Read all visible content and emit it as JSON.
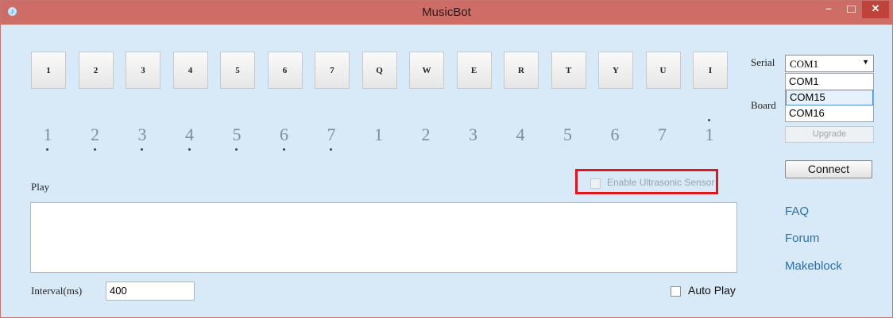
{
  "window": {
    "title": "MusicBot",
    "controls": {
      "minimize": "–",
      "close": "✕"
    }
  },
  "keys": [
    {
      "label": "1",
      "note": "1",
      "dot": "below"
    },
    {
      "label": "2",
      "note": "2",
      "dot": "below"
    },
    {
      "label": "3",
      "note": "3",
      "dot": "below"
    },
    {
      "label": "4",
      "note": "4",
      "dot": "below"
    },
    {
      "label": "5",
      "note": "5",
      "dot": "below"
    },
    {
      "label": "6",
      "note": "6",
      "dot": "below"
    },
    {
      "label": "7",
      "note": "7",
      "dot": "below"
    },
    {
      "label": "Q",
      "note": "1",
      "dot": "none"
    },
    {
      "label": "W",
      "note": "2",
      "dot": "none"
    },
    {
      "label": "E",
      "note": "3",
      "dot": "none"
    },
    {
      "label": "R",
      "note": "4",
      "dot": "none"
    },
    {
      "label": "T",
      "note": "5",
      "dot": "none"
    },
    {
      "label": "Y",
      "note": "6",
      "dot": "none"
    },
    {
      "label": "U",
      "note": "7",
      "dot": "none"
    },
    {
      "label": "I",
      "note": "1",
      "dot": "above"
    }
  ],
  "play": {
    "label": "Play",
    "content": ""
  },
  "sensor": {
    "label": "Enable Ultrasonic Sensor",
    "checked": false,
    "enabled": false,
    "highlight_color": "#e2151f"
  },
  "interval": {
    "label": "Interval(ms)",
    "value": "400"
  },
  "auto_play": {
    "label": "Auto Play",
    "checked": false
  },
  "serial": {
    "label": "Serial",
    "selected": "COM1",
    "options": [
      "COM1",
      "COM15",
      "COM16"
    ],
    "highlighted": "COM15"
  },
  "board": {
    "label": "Board"
  },
  "buttons": {
    "upgrade": "Upgrade",
    "connect": "Connect"
  },
  "links": [
    "FAQ",
    "Forum",
    "Makeblock"
  ],
  "colors": {
    "titlebar": "#cd6d66",
    "background": "#d8e9f7",
    "link": "#2c6fb0"
  }
}
